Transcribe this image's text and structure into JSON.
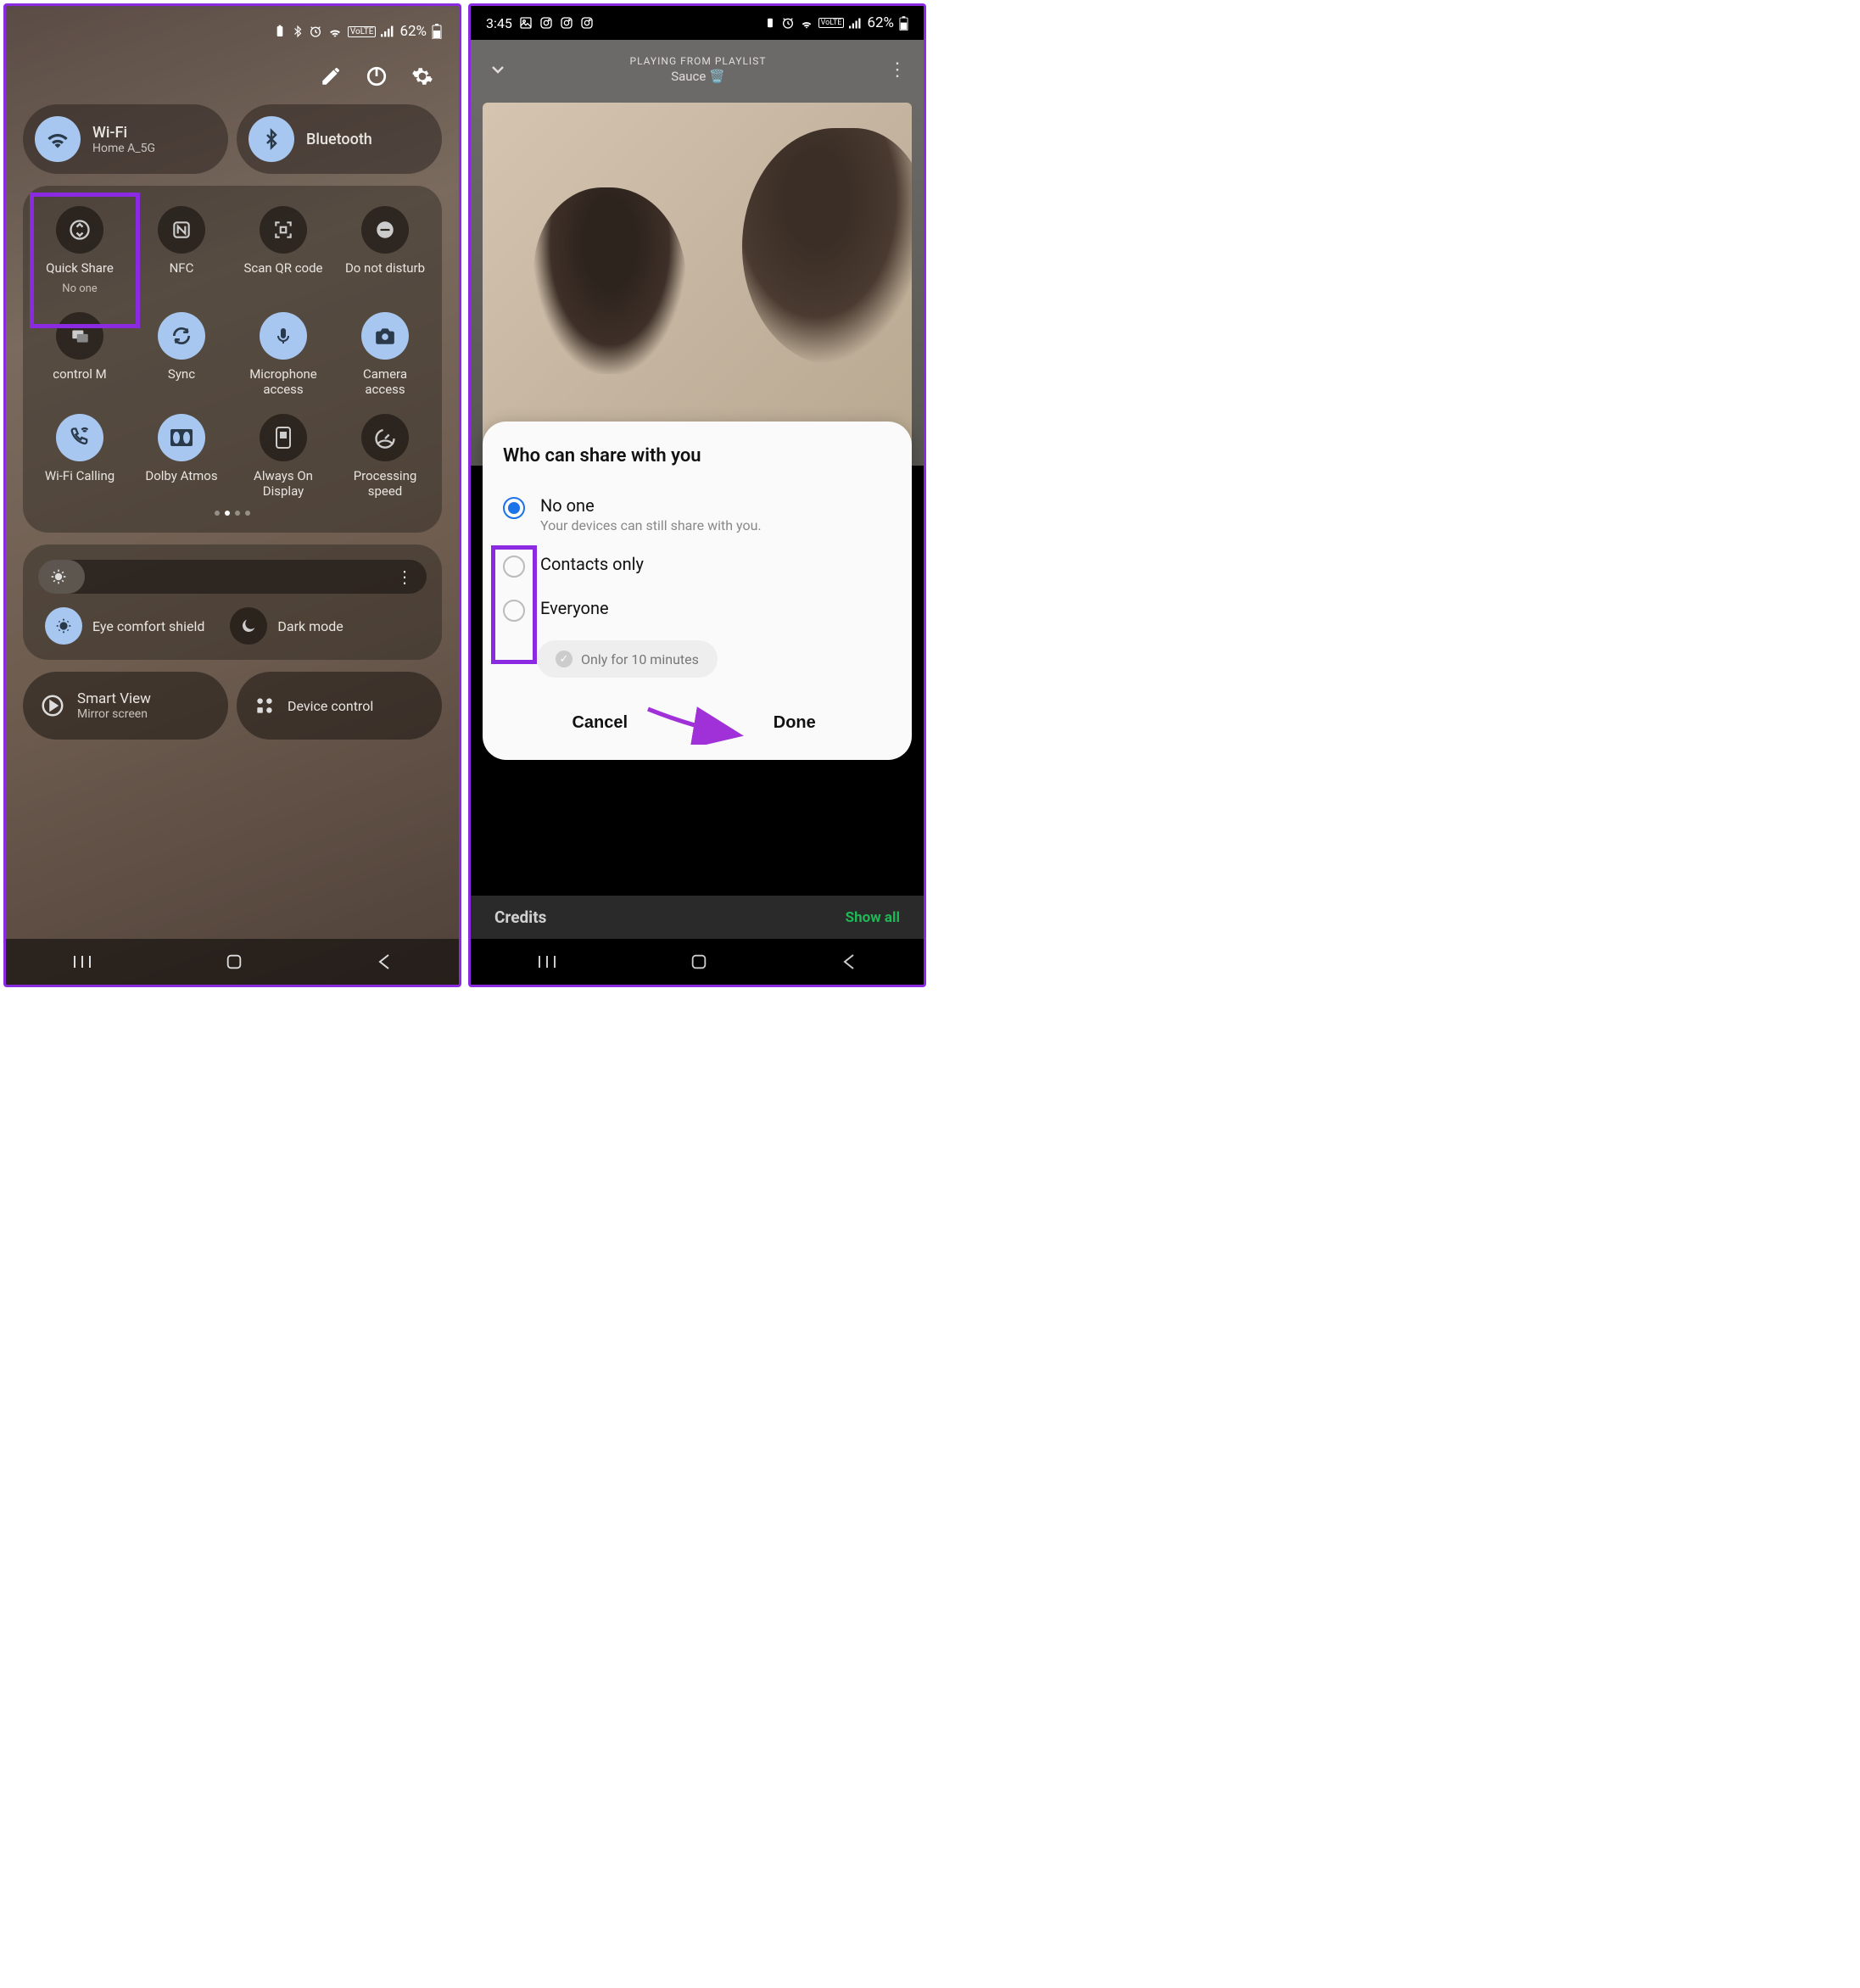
{
  "left": {
    "status": {
      "battery": "62%"
    },
    "wifi": {
      "title": "Wi-Fi",
      "sub": "Home A_5G"
    },
    "bluetooth": {
      "title": "Bluetooth"
    },
    "tiles": [
      {
        "label": "Quick Share",
        "sub": "No one"
      },
      {
        "label": "NFC"
      },
      {
        "label": "Scan QR code"
      },
      {
        "label": "Do not disturb"
      },
      {
        "label": "control   M"
      },
      {
        "label": "Sync"
      },
      {
        "label": "Microphone access"
      },
      {
        "label": "Camera access"
      },
      {
        "label": "Wi-Fi Calling"
      },
      {
        "label": "Dolby Atmos"
      },
      {
        "label": "Always On Display"
      },
      {
        "label": "Processing speed"
      }
    ],
    "eye": "Eye comfort shield",
    "dark": "Dark mode",
    "smartview": {
      "title": "Smart View",
      "sub": "Mirror screen"
    },
    "devicecontrol": "Device control"
  },
  "right": {
    "status": {
      "time": "3:45",
      "battery": "62%"
    },
    "player": {
      "context": "PLAYING FROM PLAYLIST",
      "name": "Sauce"
    },
    "sheet": {
      "title": "Who can share with you",
      "opt1": {
        "label": "No one",
        "sub": "Your devices can still share with you."
      },
      "opt2": {
        "label": "Contacts only"
      },
      "opt3": {
        "label": "Everyone"
      },
      "chip": "Only for 10 minutes",
      "cancel": "Cancel",
      "done": "Done"
    },
    "credits": {
      "label": "Credits",
      "showall": "Show all"
    }
  }
}
